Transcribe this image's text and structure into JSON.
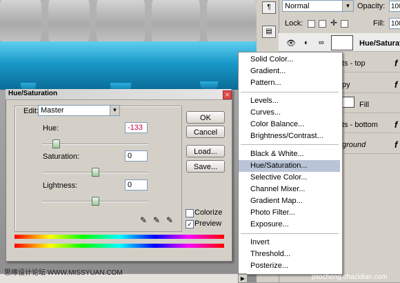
{
  "layers_panel": {
    "blend_mode": "Normal",
    "opacity_label": "Opacity:",
    "opacity_value": "100",
    "lock_label": "Lock:",
    "fill_label": "Fill:",
    "fill_value": "100",
    "layers": [
      {
        "name": "Hue/Saturation",
        "selected": true
      },
      {
        "name": "ts - top",
        "fx": "f"
      },
      {
        "name": "py",
        "fx": "f"
      },
      {
        "name": "Fill",
        "fx": ""
      },
      {
        "name": "ts - bottom",
        "fx": "f"
      },
      {
        "name": "ground",
        "fx": "f"
      }
    ]
  },
  "menu": {
    "items_group1": [
      "Solid Color...",
      "Gradient...",
      "Pattern..."
    ],
    "items_group2": [
      "Levels...",
      "Curves...",
      "Color Balance...",
      "Brightness/Contrast..."
    ],
    "items_group3": [
      "Black & White...",
      "Hue/Saturation...",
      "Selective Color...",
      "Channel Mixer...",
      "Gradient Map...",
      "Photo Filter...",
      "Exposure..."
    ],
    "items_group4": [
      "Invert",
      "Threshold...",
      "Posterize..."
    ],
    "highlighted": "Hue/Saturation..."
  },
  "dialog": {
    "title": "Hue/Saturation",
    "edit_label": "Edit:",
    "edit_value": "Master",
    "hue_label": "Hue:",
    "hue_value": "-133",
    "saturation_label": "Saturation:",
    "saturation_value": "0",
    "lightness_label": "Lightness:",
    "lightness_value": "0",
    "ok_label": "OK",
    "cancel_label": "Cancel",
    "load_label": "Load...",
    "save_label": "Save...",
    "colorize_label": "Colorize",
    "preview_label": "Preview",
    "colorize_checked": false,
    "preview_checked": true,
    "hue_level_fraction": 0.13,
    "saturation_level_fraction": 0.5,
    "lightness_level_fraction": 0.5
  },
  "watermarks": {
    "left": "思缘设计论坛 WWW.MISSYUAN.COM",
    "right": "jiaocheng.chazidian.com"
  },
  "colors": {
    "dialog_bg": "#d4d0c8",
    "menu_highlight": "#b9c4d6",
    "hue_value_color": "#c0004a"
  }
}
